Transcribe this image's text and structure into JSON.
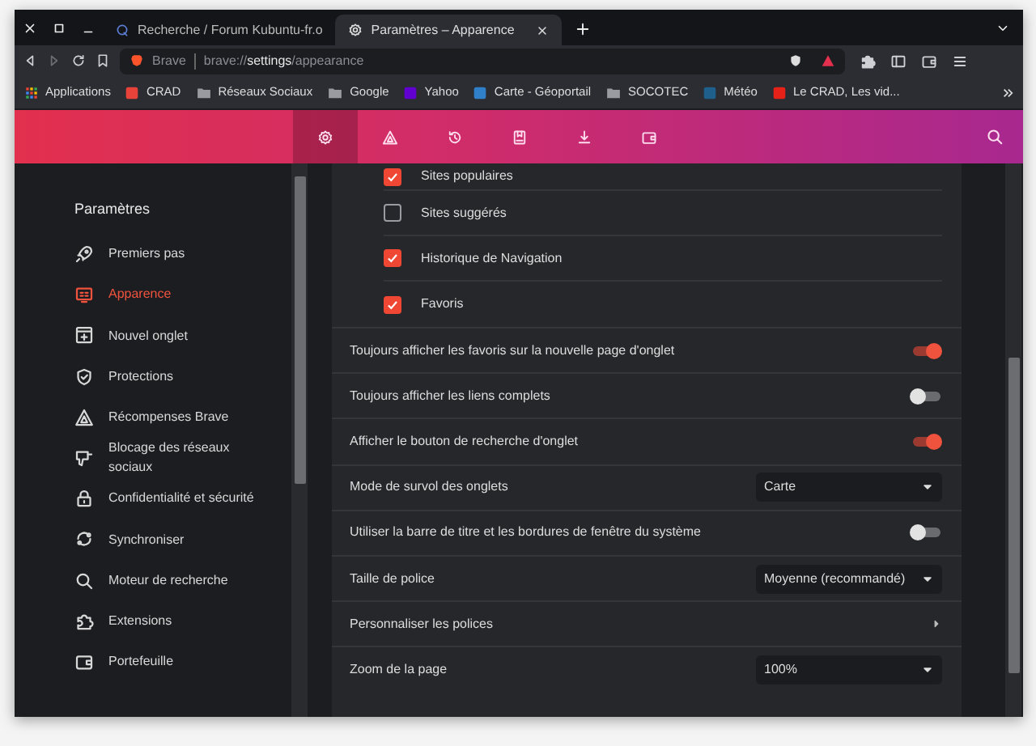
{
  "window": {
    "tabs": [
      {
        "title": "Recherche / Forum Kubuntu-fr.o",
        "selected": false
      },
      {
        "title": "Paramètres – Apparence",
        "selected": true
      }
    ]
  },
  "address_bar": {
    "site_label": "Brave",
    "url": "brave://**settings**/appearance"
  },
  "bookmarks": [
    {
      "kind": "apps",
      "label": "Applications"
    },
    {
      "kind": "site",
      "label": "CRAD",
      "color": "#e8433a"
    },
    {
      "kind": "folder",
      "label": "Réseaux Sociaux"
    },
    {
      "kind": "folder",
      "label": "Google"
    },
    {
      "kind": "site",
      "label": "Yahoo",
      "color": "#6001d2"
    },
    {
      "kind": "site",
      "label": "Carte - Géoportail",
      "color": "#2f80c8"
    },
    {
      "kind": "folder",
      "label": "SOCOTEC"
    },
    {
      "kind": "site",
      "label": "Météo",
      "color": "#1f5f8b"
    },
    {
      "kind": "site",
      "label": "Le CRAD, Les vid...",
      "color": "#e62117"
    }
  ],
  "settings_nav": [
    {
      "selected": true
    },
    {
      "selected": false
    },
    {
      "selected": false
    },
    {
      "selected": false
    },
    {
      "selected": false
    },
    {
      "selected": false
    }
  ],
  "sidebar": {
    "title": "Paramètres",
    "items": [
      {
        "label": "Premiers pas",
        "selected": false
      },
      {
        "label": "Apparence",
        "selected": true
      },
      {
        "label": "Nouvel onglet",
        "selected": false
      },
      {
        "label": "Protections",
        "selected": false
      },
      {
        "label": "Récompenses Brave",
        "selected": false
      },
      {
        "label": "Blocage des réseaux sociaux",
        "selected": false
      },
      {
        "label": "Confidentialité et sécurité",
        "selected": false
      },
      {
        "label": "Synchroniser",
        "selected": false
      },
      {
        "label": "Moteur de recherche",
        "selected": false
      },
      {
        "label": "Extensions",
        "selected": false
      },
      {
        "label": "Portefeuille",
        "selected": false
      }
    ]
  },
  "checkboxes": [
    {
      "label": "Sites populaires",
      "checked": true
    },
    {
      "label": "Sites suggérés",
      "checked": false
    },
    {
      "label": "Historique de Navigation",
      "checked": true
    },
    {
      "label": "Favoris",
      "checked": true
    }
  ],
  "settings": [
    {
      "kind": "toggle",
      "label": "Toujours afficher les favoris sur la nouvelle page d'onglet",
      "on": true
    },
    {
      "kind": "toggle",
      "label": "Toujours afficher les liens complets",
      "on": false
    },
    {
      "kind": "toggle",
      "label": "Afficher le bouton de recherche d'onglet",
      "on": true
    },
    {
      "kind": "select",
      "label": "Mode de survol des onglets",
      "value": "Carte"
    },
    {
      "kind": "toggle",
      "label": "Utiliser la barre de titre et les bordures de fenêtre du système",
      "on": false
    },
    {
      "kind": "select",
      "label": "Taille de police",
      "value": "Moyenne (recommandé)"
    },
    {
      "kind": "link",
      "label": "Personnaliser les polices"
    },
    {
      "kind": "select",
      "label": "Zoom de la page",
      "value": "100%"
    }
  ]
}
